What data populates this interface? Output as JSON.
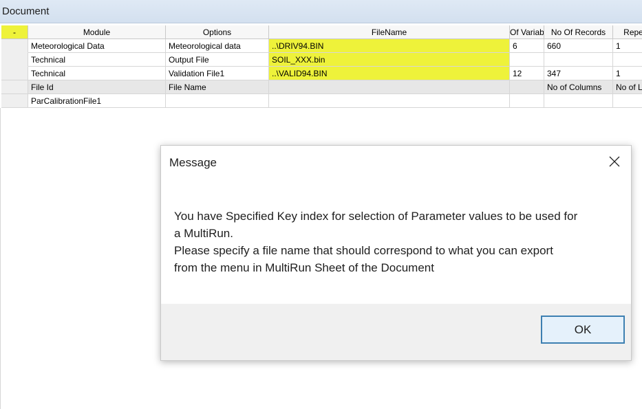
{
  "window": {
    "title": "Document"
  },
  "grid": {
    "corner": "-",
    "headers": [
      "Module",
      "Options",
      "FileName",
      "Of Variab",
      "No Of Records",
      "Repe"
    ],
    "rows": [
      [
        "Meteorological Data",
        "Meteorological data",
        "..\\DRIV94.BIN",
        "6",
        "660",
        "1"
      ],
      [
        "Technical",
        "Output File",
        "SOIL_XXX.bin",
        "",
        "",
        ""
      ],
      [
        "Technical",
        "Validation File1",
        "..\\VALID94.BIN",
        "12",
        "347",
        "1"
      ]
    ],
    "subheader": [
      "File Id",
      "File Name",
      "",
      "",
      "No of Columns",
      "No of L"
    ],
    "last_row": [
      "ParCalibrationFile1",
      "",
      "",
      "",
      "",
      ""
    ]
  },
  "dialog": {
    "title": "Message",
    "message_lines": [
      "You have Specified Key index for selection of Parameter values to be used for",
      "a MultiRun.",
      "Please specify a file name that should correspond to what you can export",
      "from the menu in MultiRun Sheet of the Document"
    ],
    "ok_label": "OK",
    "close_icon": "close-icon"
  },
  "colors": {
    "highlight": "#eef23a",
    "titlebar": "#dbe6f3",
    "button_border": "#3c7fb1",
    "button_fill": "#e5f1fb",
    "footer": "#f0f0f0"
  }
}
